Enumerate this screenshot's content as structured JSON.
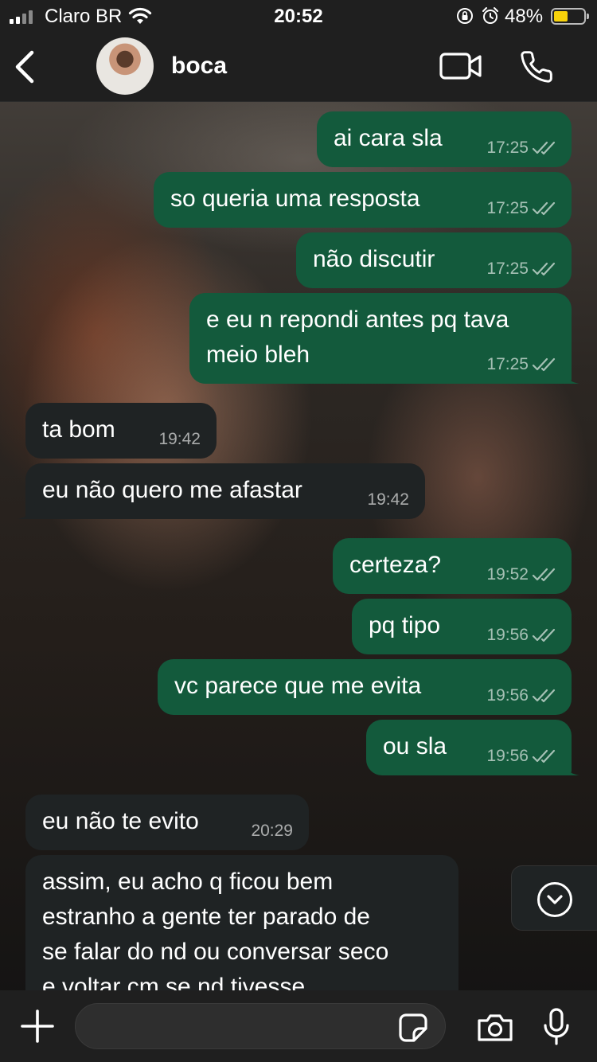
{
  "status_bar": {
    "carrier": "Claro BR",
    "time": "20:52",
    "battery_percent": "48%",
    "battery_level": 0.48,
    "battery_color": "#f7d20a"
  },
  "header": {
    "back_icon": "chevron-left-icon",
    "contact_name": "boca",
    "video_icon": "video-camera-icon",
    "call_icon": "phone-icon"
  },
  "colors": {
    "outgoing_bubble": "#135a3c",
    "incoming_bubble": "#1f2324",
    "bar_background": "#1f1f1f"
  },
  "messages": [
    {
      "direction": "out",
      "text": "ai cara sla",
      "time": "17:25",
      "status": "read"
    },
    {
      "direction": "out",
      "text": "so queria uma resposta",
      "time": "17:25",
      "status": "read"
    },
    {
      "direction": "out",
      "text": "não discutir",
      "time": "17:25",
      "status": "read"
    },
    {
      "direction": "out",
      "text": "e eu n repondi antes pq tava\nmeio bleh",
      "time": "17:25",
      "status": "read"
    },
    {
      "direction": "in",
      "text": "ta bom",
      "time": "19:42"
    },
    {
      "direction": "in",
      "text": "eu não quero me afastar",
      "time": "19:42"
    },
    {
      "direction": "out",
      "text": "certeza?",
      "time": "19:52",
      "status": "read"
    },
    {
      "direction": "out",
      "text": "pq tipo",
      "time": "19:56",
      "status": "read"
    },
    {
      "direction": "out",
      "text": "vc parece que me evita",
      "time": "19:56",
      "status": "read"
    },
    {
      "direction": "out",
      "text": "ou sla",
      "time": "19:56",
      "status": "read"
    },
    {
      "direction": "in",
      "text": "eu não te evito",
      "time": "20:29"
    },
    {
      "direction": "in",
      "text": "assim, eu acho q ficou bem\nestranho a gente ter parado de\nse falar do nd ou conversar seco\ne voltar cm se nd tivesse"
    }
  ],
  "composer": {
    "plus_icon": "plus-icon",
    "input_value": "",
    "sticker_icon": "sticker-icon",
    "camera_icon": "camera-icon",
    "mic_icon": "microphone-icon"
  },
  "scroll_button_icon": "chevron-down-circle-icon"
}
